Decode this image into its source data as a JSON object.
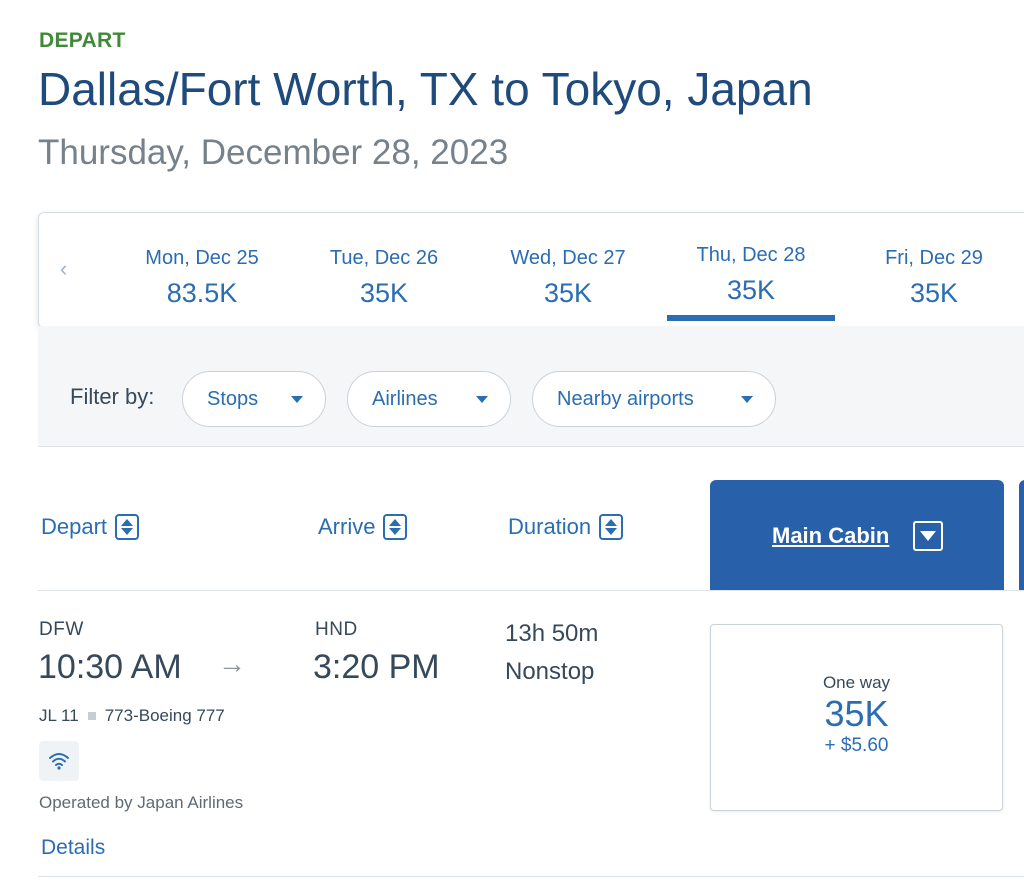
{
  "header": {
    "section_label": "DEPART",
    "route": "Dallas/Fort Worth, TX to Tokyo, Japan",
    "date": "Thursday, December 28, 2023"
  },
  "date_strip": {
    "prev_symbol": "‹",
    "dates": [
      {
        "day": "Mon, Dec 25",
        "price": "83.5K"
      },
      {
        "day": "Tue, Dec 26",
        "price": "35K"
      },
      {
        "day": "Wed, Dec 27",
        "price": "35K"
      },
      {
        "day": "Thu, Dec 28",
        "price": "35K",
        "selected": true
      },
      {
        "day": "Fri, Dec 29",
        "price": "35K"
      }
    ]
  },
  "filters": {
    "label": "Filter by:",
    "items": [
      "Stops",
      "Airlines",
      "Nearby airports"
    ]
  },
  "columns": {
    "depart": "Depart",
    "arrive": "Arrive",
    "duration": "Duration",
    "cabin": "Main Cabin"
  },
  "flight": {
    "origin_code": "DFW",
    "depart_time": "10:30 AM",
    "dest_code": "HND",
    "arrive_time": "3:20 PM",
    "duration": "13h 50m",
    "stops": "Nonstop",
    "flight_number": "JL 11",
    "aircraft": "773-Boeing 777",
    "operated_by": "Operated by Japan Airlines",
    "details_link": "Details"
  },
  "fare": {
    "label": "One way",
    "price": "35K",
    "taxes": "+ $5.60"
  },
  "colors": {
    "accent": "#2a6db2",
    "depart_green": "#3f8a36",
    "cabin_header": "#2860a9"
  }
}
